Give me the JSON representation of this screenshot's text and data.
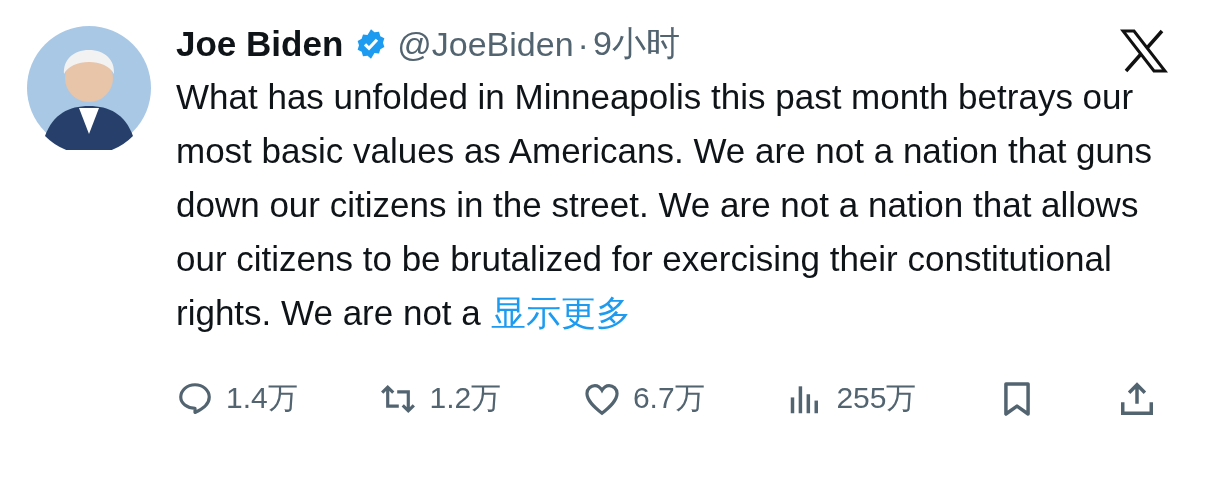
{
  "author": {
    "name": "Joe Biden",
    "verified": true,
    "handle": "@JoeBiden",
    "separator": "·",
    "time": "9小时"
  },
  "body": {
    "text": "What has unfolded in Minneapolis this past month betrays our most basic values as Americans. We are not a nation that guns down our citizens in the street. We are not a nation that allows our citizens to be brutalized for exercising their constitutional rights. We are not a",
    "show_more": "显示更多"
  },
  "actions": [
    {
      "kind": "reply",
      "count": "1.4万"
    },
    {
      "kind": "repost",
      "count": "1.2万"
    },
    {
      "kind": "like",
      "count": "6.7万"
    },
    {
      "kind": "views",
      "count": "255万"
    },
    {
      "kind": "bookmark"
    },
    {
      "kind": "share"
    }
  ]
}
